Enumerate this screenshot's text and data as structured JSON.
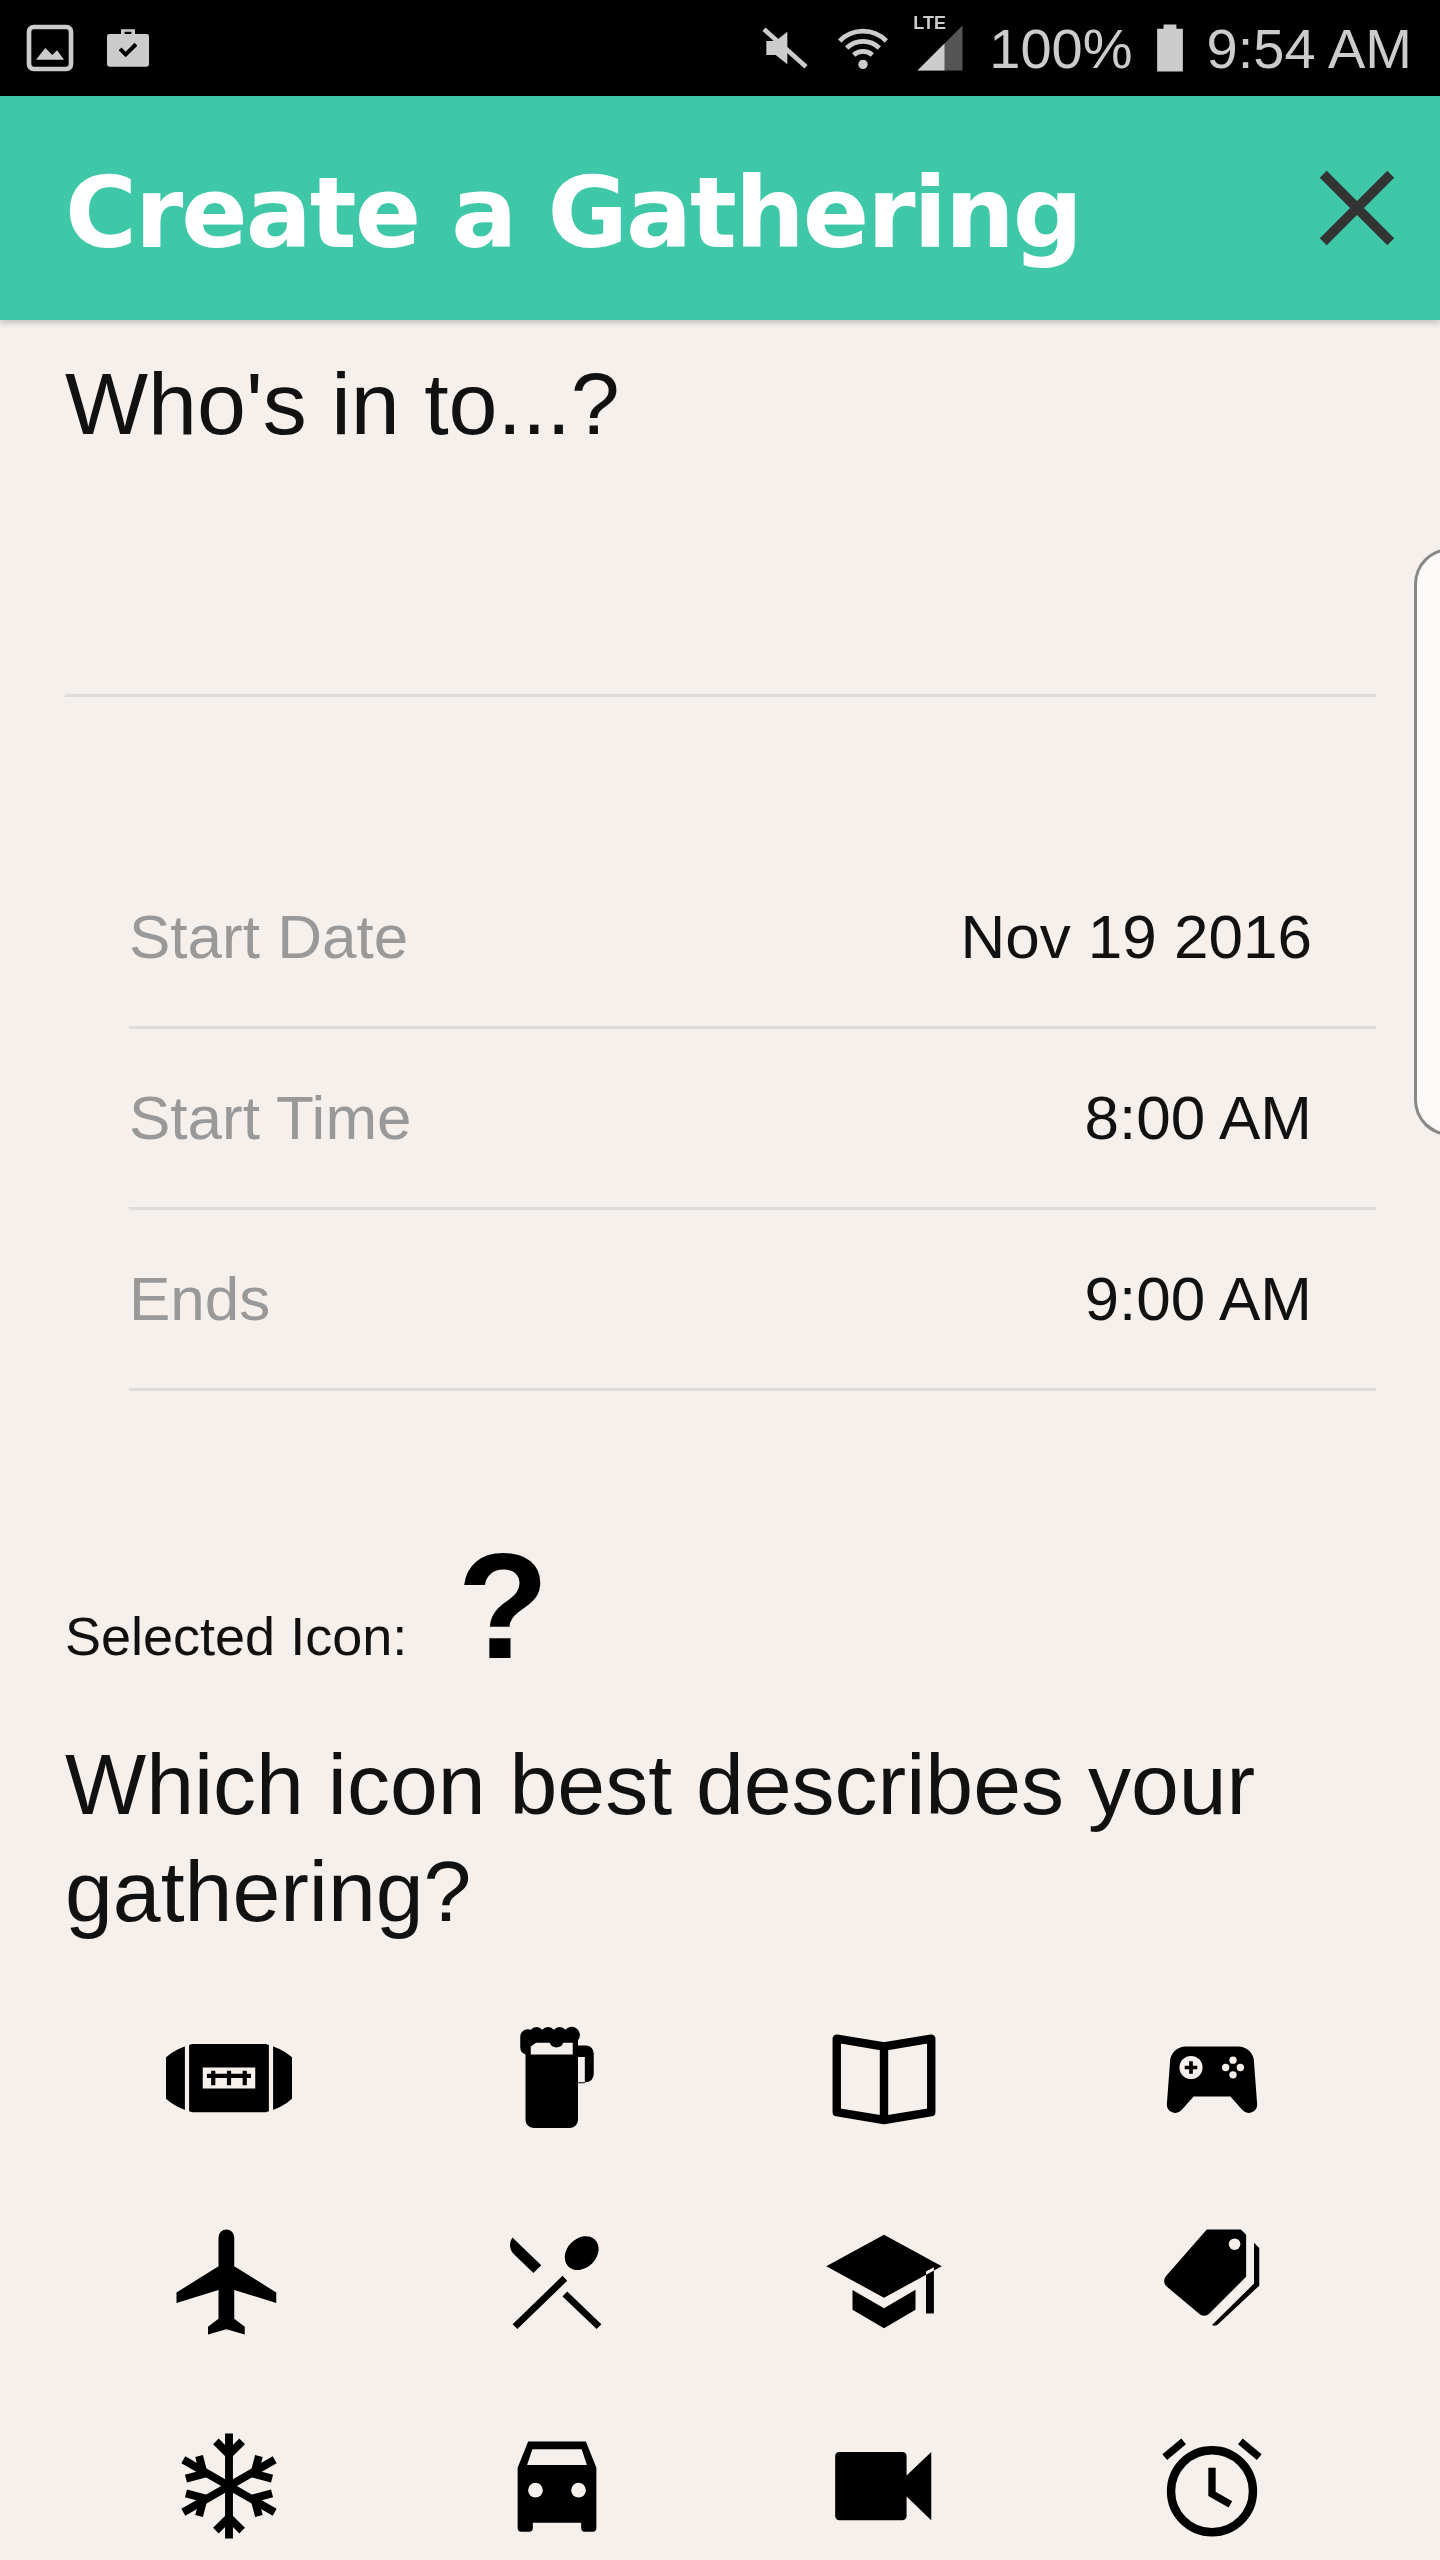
{
  "status_bar": {
    "network": "LTE",
    "battery": "100%",
    "time": "9:54 AM"
  },
  "app_bar": {
    "title": "Create a Gathering"
  },
  "question": {
    "label": "Who's in to...?"
  },
  "schedule": [
    {
      "label": "Start Date",
      "value": "Nov 19 2016"
    },
    {
      "label": "Start Time",
      "value": "8:00 AM"
    },
    {
      "label": "Ends",
      "value": "9:00 AM"
    }
  ],
  "selected_icon": {
    "label": "Selected Icon:",
    "value": "?"
  },
  "icon_prompt": "Which icon best describes your gathering?",
  "icons": [
    {
      "kind": "football"
    },
    {
      "kind": "beer"
    },
    {
      "kind": "book"
    },
    {
      "kind": "gamepad"
    },
    {
      "kind": "plane"
    },
    {
      "kind": "dining"
    },
    {
      "kind": "school"
    },
    {
      "kind": "tag"
    },
    {
      "kind": "snowflake"
    },
    {
      "kind": "car"
    },
    {
      "kind": "video"
    },
    {
      "kind": "alarm"
    }
  ]
}
